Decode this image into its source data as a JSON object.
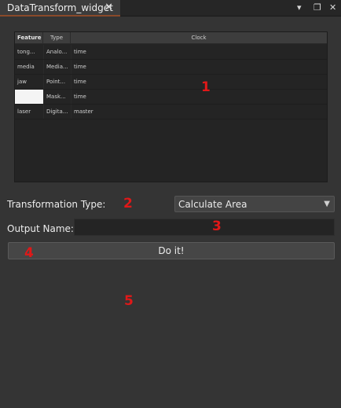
{
  "tab": {
    "title": "DataTransform_widget",
    "close_icon": "close-icon"
  },
  "title_bar_icons": [
    "dock-menu-icon",
    "float-icon",
    "close-icon"
  ],
  "table": {
    "headers": [
      "Feature",
      "Type",
      "Clock"
    ],
    "rows": [
      {
        "feature": "tong...",
        "type": "Analo...",
        "clock": "time"
      },
      {
        "feature": "media",
        "type": "Media...",
        "clock": "time"
      },
      {
        "feature": "jaw",
        "type": "Point...",
        "clock": "time"
      },
      {
        "feature": "",
        "type": "Mask...",
        "clock": "time",
        "selected": true
      },
      {
        "feature": "laser",
        "type": "Digita...",
        "clock": "master"
      }
    ]
  },
  "transformation": {
    "label": "Transformation Type:",
    "selected": "Calculate Area"
  },
  "output": {
    "label": "Output Name:",
    "value": ""
  },
  "action": {
    "label": "Do it!"
  },
  "annotations": [
    "1",
    "2",
    "3",
    "4",
    "5"
  ],
  "colors": {
    "background": "#343434",
    "tab_accent": "#8a4a2a",
    "annotation": "#e01818"
  }
}
